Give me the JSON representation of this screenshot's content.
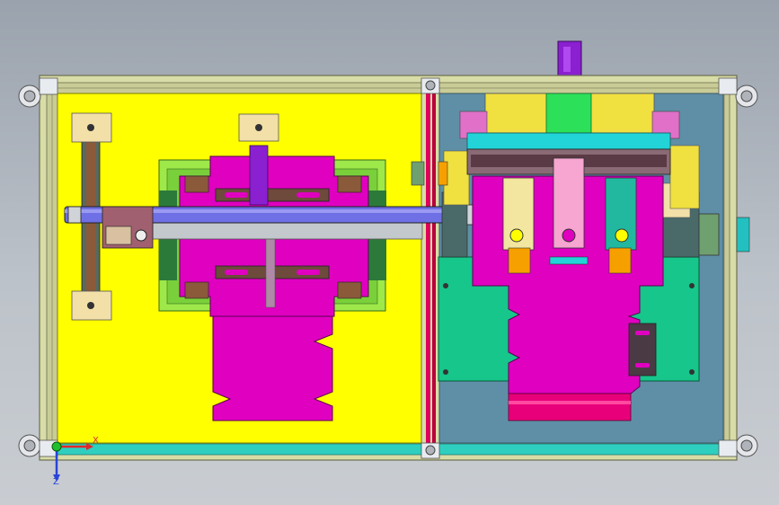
{
  "viewport": {
    "background_top": "#9aa2ad",
    "background_bottom": "#c9cdd2"
  },
  "triad": {
    "x_label": "X",
    "y_label": "Y",
    "z_label": "Z",
    "x_color": "#e0272b",
    "y_color": "#1fbf2e",
    "z_color": "#2844d8"
  },
  "colors": {
    "frame": "#d8dca6",
    "frame_edge": "#6d6f52",
    "left_plate": "#ffff00",
    "right_plate": "#5f8fa6",
    "magenta": "#e000c0",
    "green_plate": "#16c68a",
    "light_green": "#9ee84a",
    "cylinder": "#6f6fe6",
    "purple": "#8a20d0",
    "brown": "#6e4a3c",
    "cyan": "#22d4d8",
    "pink": "#f6a6d0",
    "orange": "#f6a000",
    "teal": "#22b8a0"
  }
}
